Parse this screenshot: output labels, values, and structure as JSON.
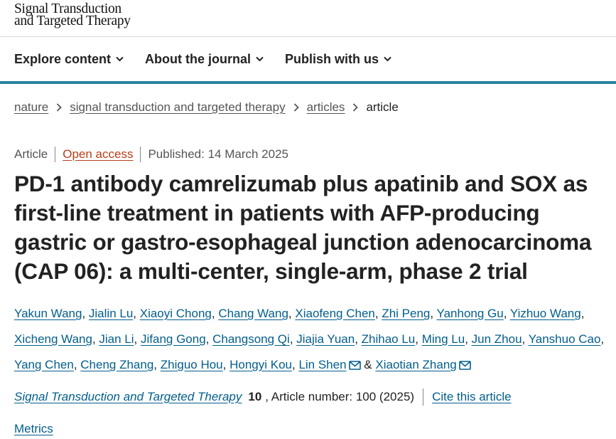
{
  "header": {
    "logo_line1": "Signal Transduction",
    "logo_line2": "and Targeted Therapy"
  },
  "nav": {
    "items": [
      {
        "label": "Explore content",
        "icon": "chevron-down-icon"
      },
      {
        "label": "About the journal",
        "icon": "chevron-down-icon"
      },
      {
        "label": "Publish with us",
        "icon": "chevron-down-icon"
      }
    ]
  },
  "breadcrumb": {
    "items": [
      "nature",
      "signal transduction and targeted therapy",
      "articles"
    ],
    "current": "article",
    "separator_icon": "chevron-right-icon"
  },
  "article": {
    "type": "Article",
    "access": "Open access",
    "published": "Published: 14 March 2025",
    "title": "PD-1 antibody camrelizumab plus apatinib and SOX as first-line treatment in patients with AFP-producing gastric or gastro-esophageal junction adenocarcinoma (CAP 06): a multi-center, single-arm, phase 2 trial"
  },
  "authors": {
    "names": [
      "Yakun Wang",
      "Jialin Lu",
      "Xiaoyi Chong",
      "Chang Wang",
      "Xiaofeng Chen",
      "Zhi Peng",
      "Yanhong Gu",
      "Yizhuo Wang",
      "Xicheng Wang",
      "Jian Li",
      "Jifang Gong",
      "Changsong Qi",
      "Jiajia Yuan",
      "Zhihao Lu",
      "Ming Lu",
      "Jun Zhou",
      "Yanshuo Cao",
      "Yang Chen",
      "Cheng Zhang",
      "Zhiguo Hou",
      "Hongyi Kou",
      "Lin Shen",
      "Xiaotian Zhang"
    ],
    "corresponding": [
      "Lin Shen",
      "Xiaotian Zhang"
    ],
    "ampersand": "&",
    "mail_icon": "mail-icon"
  },
  "citation": {
    "journal": "Signal Transduction and Targeted Therapy",
    "volume": "10",
    "article_number": ", Article number: 100 (2025)",
    "cite_label": "Cite this article"
  },
  "metrics_label": "Metrics",
  "colors": {
    "link": "#025e8d",
    "open_access": "#b83e17",
    "nav_border": "#29849e",
    "text": "#222222"
  }
}
